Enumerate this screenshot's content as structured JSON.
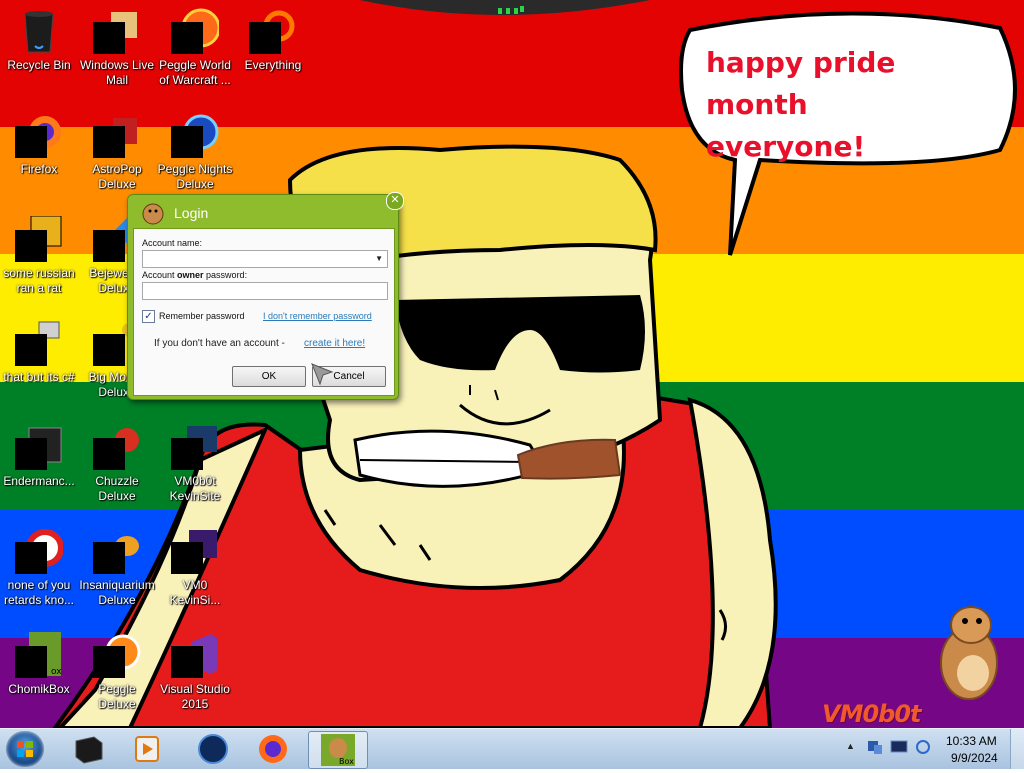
{
  "wallpaper": {
    "speech_bubble": "happy pride month\neveryone!",
    "signature": "VM0b0t"
  },
  "desktop_icons": [
    {
      "label": "Recycle Bin",
      "icon": "recycle-bin-icon"
    },
    {
      "label": "Windows Live Mail",
      "icon": "mail-icon"
    },
    {
      "label": "Peggle World of Warcraft ...",
      "icon": "peggle-icon"
    },
    {
      "label": "Everything",
      "icon": "search-icon"
    },
    {
      "label": "Firefox",
      "icon": "firefox-icon"
    },
    {
      "label": "AstroPop Deluxe",
      "icon": "astropop-icon"
    },
    {
      "label": "Peggle Nights Deluxe",
      "icon": "peggle-icon"
    },
    {
      "label": "some russian ran a rat",
      "icon": "app-icon"
    },
    {
      "label": "Bejeweled Deluxe",
      "icon": "bejeweled-icon"
    },
    {
      "label": "that but its c#",
      "icon": "window-icon"
    },
    {
      "label": "Big Money Deluxe",
      "icon": "game-icon"
    },
    {
      "label": "Endermanc...",
      "icon": "terminal-icon"
    },
    {
      "label": "Chuzzle Deluxe",
      "icon": "chuzzle-icon"
    },
    {
      "label": "VM0b0t KevinSite",
      "icon": "website-icon"
    },
    {
      "label": "none of you retards kno...",
      "icon": "app-icon"
    },
    {
      "label": "Insaniquarium Deluxe",
      "icon": "fish-icon"
    },
    {
      "label": "VM0 KevinSi...",
      "icon": "website-icon"
    },
    {
      "label": "ChomikBox",
      "icon": "hamster-icon"
    },
    {
      "label": "Peggle Deluxe",
      "icon": "peggle-icon"
    },
    {
      "label": "Visual Studio 2015",
      "icon": "visual-studio-icon"
    }
  ],
  "login_dialog": {
    "title": "Login",
    "account_name_label": "Account name:",
    "account_name_value": "",
    "password_label_pre": "Account ",
    "password_label_bold": "owner",
    "password_label_post": " password:",
    "password_value": "",
    "remember_label": "Remember password",
    "remember_checked": true,
    "forgot_link": "I don't remember password",
    "no_account_text": "If you don't have an account - ",
    "create_link": "create it here!",
    "ok_label": "OK",
    "cancel_label": "Cancel",
    "accent_color": "#8fbc2c"
  },
  "taskbar": {
    "pinned": [
      {
        "icon": "cmd-window-icon"
      },
      {
        "icon": "media-player-icon"
      },
      {
        "icon": "globe-icon"
      },
      {
        "icon": "firefox-icon"
      },
      {
        "icon": "chomikbox-icon",
        "active": true
      }
    ],
    "tray_icons": [
      "network-icon",
      "monitor-icon",
      "update-icon"
    ],
    "time": "10:33 AM",
    "date": "9/9/2024"
  }
}
